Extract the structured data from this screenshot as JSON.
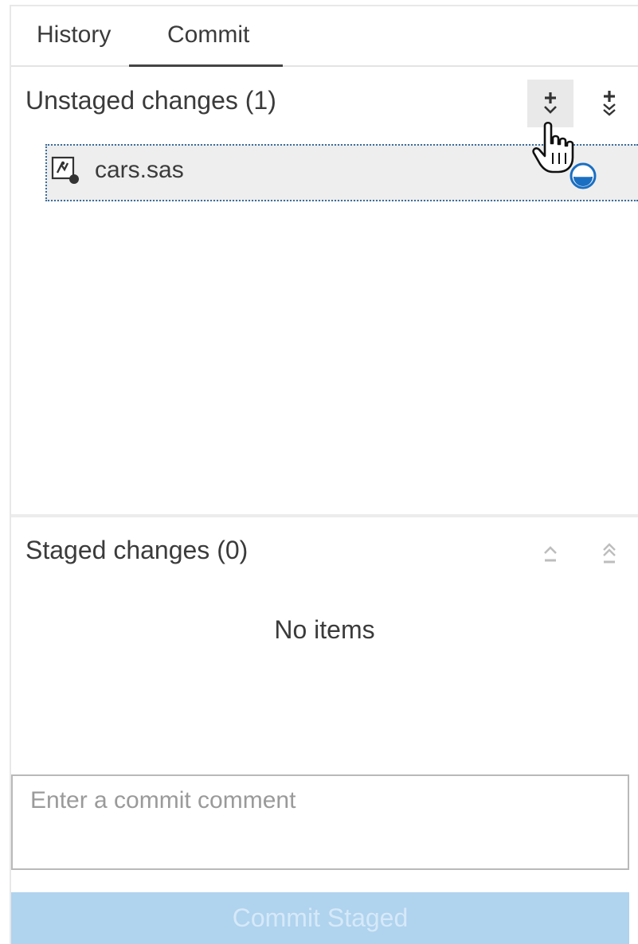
{
  "tabs": [
    {
      "label": "History",
      "active": false
    },
    {
      "label": "Commit",
      "active": true
    }
  ],
  "unstaged": {
    "title": "Unstaged changes (1)",
    "files": [
      {
        "name": "cars.sas",
        "icon": "sas-program-icon",
        "status_icon": "modified-status-icon"
      }
    ],
    "actions": [
      "stage-selected-icon",
      "stage-all-icon"
    ]
  },
  "staged": {
    "title": "Staged changes (0)",
    "empty_text": "No items",
    "actions": [
      "unstage-selected-icon",
      "unstage-all-icon"
    ]
  },
  "commit": {
    "comment_placeholder": "Enter a commit comment",
    "comment_value": "",
    "button_label": "Commit Staged",
    "button_enabled": false
  },
  "colors": {
    "accent": "#1b6fc2",
    "button_disabled_bg": "#b0d3ee",
    "button_disabled_text": "#d6e9f8",
    "row_highlight": "#eeeeee",
    "focus_outline": "#3b6e9c"
  }
}
